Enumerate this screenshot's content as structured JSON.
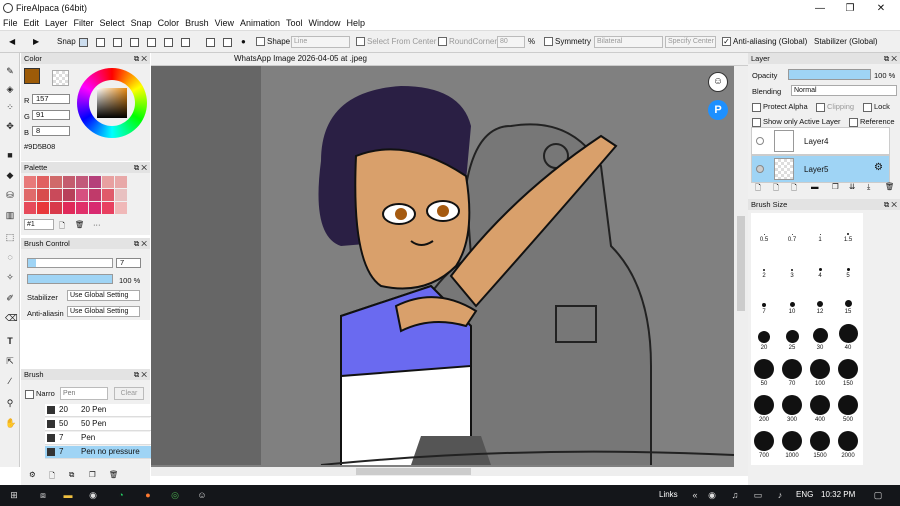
{
  "window": {
    "title": "FireAlpaca (64bit)",
    "minimize": "—",
    "maximize": "❐",
    "close": "✕"
  },
  "menu": [
    "File",
    "Edit",
    "Layer",
    "Filter",
    "Select",
    "Snap",
    "Color",
    "Brush",
    "View",
    "Animation",
    "Tool",
    "Window",
    "Help"
  ],
  "toolbar": {
    "snap_label": "Snap",
    "shape_label": "Shape",
    "shape_value": "Line",
    "select_from_center": "Select From Center",
    "round_corner": "RoundCorner",
    "round_corner_value": "80",
    "percent": "%",
    "symmetry": "Symmetry",
    "symmetry_value": "Bilateral",
    "specify_center": "Specify Center",
    "anti_aliasing": "Anti-aliasing (Global)",
    "stabilizer": "Stabilizer (Global)"
  },
  "color_panel": {
    "title": "Color",
    "r_label": "R",
    "r": "157",
    "g_label": "G",
    "g": "91",
    "b_label": "B",
    "b": "8",
    "hex": "#9D5B08",
    "primary_color": "#9D5B08"
  },
  "palette_panel": {
    "title": "Palette",
    "preset": "#1",
    "more": "···",
    "swatches": [
      "#e87a7a",
      "#e06060",
      "#d06a6a",
      "#c45c6e",
      "#c2597a",
      "#b5407a",
      "#e8a0a0",
      "#e8a8a8",
      "#e06a6a",
      "#d84d4d",
      "#c94a5a",
      "#b8405a",
      "#d65080",
      "#c03a6a",
      "#e05a6a",
      "#e8c0c0",
      "#e64a5a",
      "#e8383a",
      "#d83a4a",
      "#e02a5a",
      "#e0306a",
      "#d82a70",
      "#e84060",
      "#f0b8b8"
    ]
  },
  "brush_control": {
    "title": "Brush Control",
    "size_value": "7",
    "opacity_value": "100 %",
    "stabilizer_label": "Stabilizer",
    "stabilizer_value": "Use Global Setting",
    "antialias_label": "Anti-aliasin",
    "antialias_value": "Use Global Setting"
  },
  "brush_panel": {
    "title": "Brush",
    "narrow_label": "Narro",
    "search_placeholder": "Pen",
    "clear_label": "Clear",
    "items": [
      {
        "size": "20",
        "name": "20 Pen"
      },
      {
        "size": "50",
        "name": "50 Pen"
      },
      {
        "size": "7",
        "name": "Pen"
      },
      {
        "size": "7",
        "name": "Pen no pressure"
      }
    ]
  },
  "document": {
    "tab_title": "WhatsApp Image 2026-04-05 at .jpeg"
  },
  "layer_panel": {
    "title": "Layer",
    "opacity_label": "Opacity",
    "opacity_value": "100 %",
    "opacity_fraction": 1.0,
    "blending_label": "Blending",
    "blending_value": "Normal",
    "protect_alpha": "Protect Alpha",
    "clipping": "Clipping",
    "lock": "Lock",
    "show_only_active": "Show only Active Layer",
    "reference": "Reference",
    "layers": [
      {
        "name": "Layer4",
        "active": false
      },
      {
        "name": "Layer5",
        "active": true
      }
    ]
  },
  "brush_size_panel": {
    "title": "Brush Size",
    "sizes": [
      "0.5",
      "0.7",
      "1",
      "1.5",
      "2",
      "3",
      "4",
      "5",
      "7",
      "10",
      "12",
      "15",
      "20",
      "25",
      "30",
      "40",
      "50",
      "70",
      "100",
      "150",
      "200",
      "300",
      "400",
      "500",
      "700",
      "1000",
      "1500",
      "2000"
    ]
  },
  "taskbar": {
    "links": "Links",
    "lang": "ENG",
    "time": "10:32 PM"
  }
}
